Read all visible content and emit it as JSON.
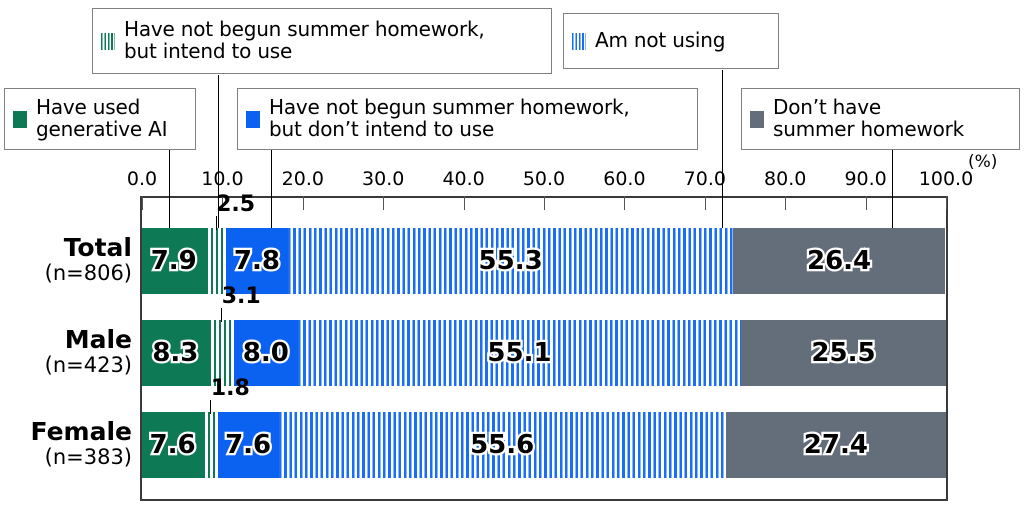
{
  "chart_data": {
    "type": "bar",
    "orientation": "horizontal",
    "stacked": true,
    "title": "",
    "xlabel": "",
    "ylabel": "",
    "unit_label": "(%)",
    "xlim": [
      0.0,
      100.0
    ],
    "grid": false,
    "legend_position": "top",
    "x_ticks": [
      "0.0",
      "10.0",
      "20.0",
      "30.0",
      "40.0",
      "50.0",
      "60.0",
      "70.0",
      "80.0",
      "90.0",
      "100.0"
    ],
    "x_tick_values": [
      0,
      10,
      20,
      30,
      40,
      50,
      60,
      70,
      80,
      90,
      100
    ],
    "categories": [
      "Total",
      "Male",
      "Female"
    ],
    "category_sublabels": [
      "(n=806)",
      "(n=423)",
      "(n=383)"
    ],
    "series": [
      {
        "name": "Have used\ngenerative AI",
        "color": "#0d7a55",
        "pattern": "solid",
        "values": [
          7.9,
          8.3,
          7.6
        ]
      },
      {
        "name": "Have not begun summer homework,\nbut intend to use",
        "color": "#0d7a55",
        "pattern": "vertical-stripes",
        "values": [
          2.5,
          3.1,
          1.8
        ]
      },
      {
        "name": "Have not begun summer homework,\nbut don’t intend to use",
        "color": "#0c62f0",
        "pattern": "solid",
        "values": [
          7.8,
          8.0,
          7.6
        ]
      },
      {
        "name": "Am not using",
        "color": "#1a6ef5",
        "pattern": "vertical-stripes",
        "values": [
          55.3,
          55.1,
          55.6
        ]
      },
      {
        "name": "Don’t have\nsummer homework",
        "color": "#646e7a",
        "pattern": "solid",
        "values": [
          26.4,
          25.5,
          27.4
        ]
      }
    ],
    "rows": [
      {
        "label": "Total",
        "sublabel": "(n=806)",
        "values": [
          7.9,
          2.5,
          7.8,
          55.3,
          26.4
        ],
        "labels": [
          "7.9",
          "2.5",
          "7.8",
          "55.3",
          "26.4"
        ]
      },
      {
        "label": "Male",
        "sublabel": "(n=423)",
        "values": [
          8.3,
          3.1,
          8.0,
          55.1,
          25.5
        ],
        "labels": [
          "8.3",
          "3.1",
          "8.0",
          "55.1",
          "25.5"
        ]
      },
      {
        "label": "Female",
        "sublabel": "(n=383)",
        "values": [
          7.6,
          1.8,
          7.6,
          55.6,
          27.4
        ],
        "labels": [
          "7.6",
          "1.8",
          "7.6",
          "55.6",
          "27.4"
        ]
      }
    ]
  },
  "legend": {
    "items": [
      {
        "label": "Have used\ngenerative AI",
        "swatch": "solid-green-swatch"
      },
      {
        "label": "Have not begun summer homework,\nbut intend to use",
        "swatch": "hatched-green-swatch"
      },
      {
        "label": "Have not begun summer homework,\nbut don’t intend to use",
        "swatch": "solid-blue-swatch"
      },
      {
        "label": "Am not using",
        "swatch": "hatched-blue-swatch"
      },
      {
        "label": "Don’t have\nsummer homework",
        "swatch": "solid-gray-swatch"
      }
    ]
  },
  "axis": {
    "unit": "(%)",
    "ticks": [
      "0.0",
      "10.0",
      "20.0",
      "30.0",
      "40.0",
      "50.0",
      "60.0",
      "70.0",
      "80.0",
      "90.0",
      "100.0"
    ]
  },
  "rows": [
    {
      "label": "Total",
      "sublabel": "(n=806)"
    },
    {
      "label": "Male",
      "sublabel": "(n=423)"
    },
    {
      "label": "Female",
      "sublabel": "(n=383)"
    }
  ],
  "callouts": [
    {
      "row": "Total",
      "value": "2.5"
    },
    {
      "row": "Male",
      "value": "3.1"
    },
    {
      "row": "Female",
      "value": "1.8"
    }
  ]
}
